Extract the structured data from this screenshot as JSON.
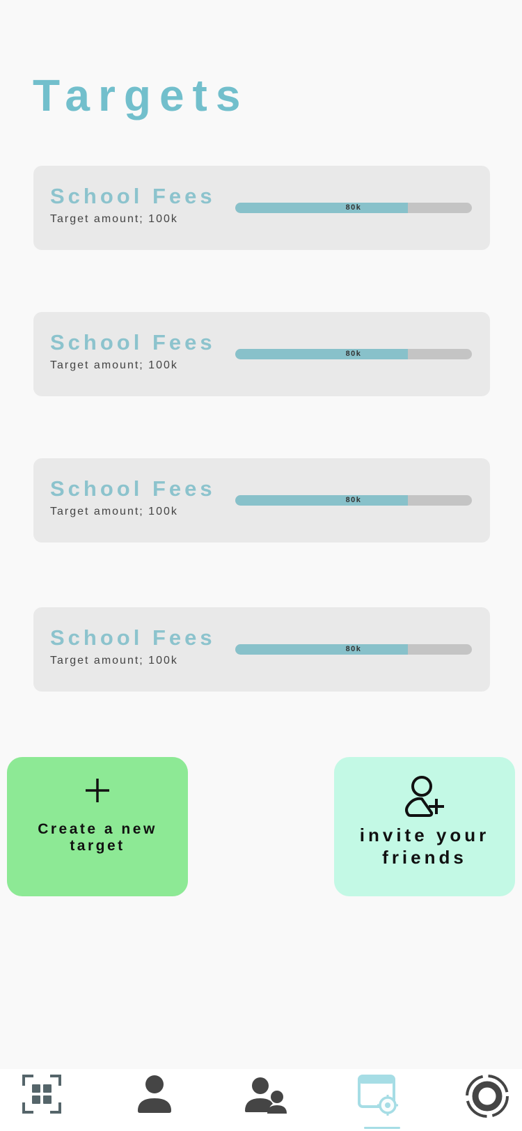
{
  "page": {
    "title": "Targets"
  },
  "targets": [
    {
      "name": "School Fees",
      "subtitle": "Target amount; 100k",
      "progress_label": "80k",
      "progress": 0.73
    },
    {
      "name": "School Fees",
      "subtitle": "Target amount; 100k",
      "progress_label": "80k",
      "progress": 0.73
    },
    {
      "name": "School Fees",
      "subtitle": "Target amount; 100k",
      "progress_label": "80k",
      "progress": 0.73
    },
    {
      "name": "School Fees",
      "subtitle": "Target amount; 100k",
      "progress_label": "80k",
      "progress": 0.73
    }
  ],
  "actions": {
    "create": {
      "label_line1": "Create a new",
      "label_line2": "target",
      "icon": "plus-icon"
    },
    "invite": {
      "label_line1": "invite your",
      "label_line2": "friends",
      "icon": "add-user-icon"
    }
  },
  "tabbar": {
    "tabs": [
      {
        "icon": "grid-scan-icon",
        "active": false
      },
      {
        "icon": "user-icon",
        "active": false
      },
      {
        "icon": "users-icon",
        "active": false
      },
      {
        "icon": "targets-icon",
        "active": true
      },
      {
        "icon": "ring-icon",
        "active": false
      }
    ]
  },
  "colors": {
    "accent": "#72bfcc",
    "card_title": "#8cc3cd",
    "progress_fill": "#88c1ca",
    "progress_track": "#c4c4c4",
    "create_bg": "#8de995",
    "invite_bg": "#c3f9e5",
    "active_tab": "#a6dde5",
    "inactive_tab": "#555555"
  }
}
